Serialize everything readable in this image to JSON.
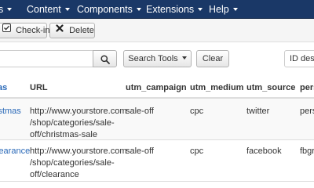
{
  "nav": {
    "items": [
      {
        "label": "s"
      },
      {
        "label": "Content"
      },
      {
        "label": "Components"
      },
      {
        "label": "Extensions"
      },
      {
        "label": "Help"
      }
    ]
  },
  "toolbar": {
    "checkin_label": "Check-in",
    "delete_label": "Delete"
  },
  "filters": {
    "search_value": "",
    "search_tools_label": "Search Tools",
    "clear_label": "Clear",
    "sort_selected": "ID desc"
  },
  "table": {
    "headers": {
      "name": "as",
      "url": "URL",
      "utm_campaign": "utm_campaign",
      "utm_medium": "utm_medium",
      "utm_source": "utm_source",
      "extra": "pers"
    },
    "rows": [
      {
        "name": "istmas",
        "url_lines": [
          "http://www.yourstore.com",
          "/shop/categories/sale-",
          "off/christmas-sale"
        ],
        "utm_campaign": "sale-off",
        "utm_medium": "cpc",
        "utm_source": "twitter",
        "extra": "pers"
      },
      {
        "name": "learance",
        "url_lines": [
          "http://www.yourstore.com",
          "/shop/categories/sale-",
          "off/clearance"
        ],
        "utm_campaign": "sale-off",
        "utm_medium": "cpc",
        "utm_source": "facebook",
        "extra": "fbgr"
      }
    ]
  },
  "colors": {
    "navbar": "#1a3867",
    "link": "#2a69b8",
    "toolbar": "#f5f5f5"
  }
}
